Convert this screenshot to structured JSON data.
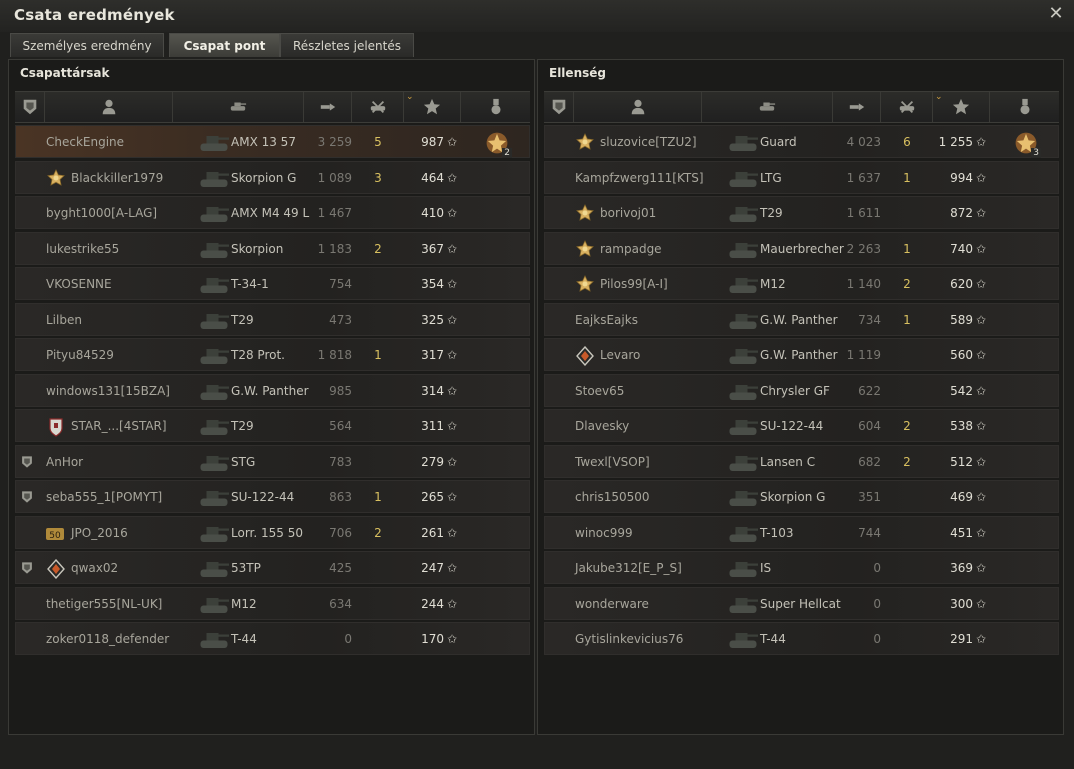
{
  "window": {
    "title": "Csata eredmények"
  },
  "tabs": [
    {
      "label": "Személyes eredmény",
      "active": false
    },
    {
      "label": "Csapat pont",
      "active": true
    },
    {
      "label": "Részletes jelentés",
      "active": false
    }
  ],
  "header_icons": [
    "platoon-icon",
    "player-icon",
    "tank-icon",
    "damage-icon",
    "kills-icon",
    "xp-star-icon",
    "medal-icon"
  ],
  "teams": [
    {
      "title": "Csapattársak",
      "rows": [
        {
          "player": "CheckEngine",
          "tank": "AMX 13 57",
          "damage": "3 259",
          "kills": "5",
          "xp": "987",
          "self": true,
          "medal": "2"
        },
        {
          "player": "Blackkiller1979",
          "tank": "Skorpion G",
          "damage": "1 089",
          "kills": "3",
          "xp": "464",
          "sticker": "gold"
        },
        {
          "player": "byght1000[A-LAG]",
          "tank": "AMX M4 49 L",
          "damage": "1 467",
          "kills": "",
          "xp": "410"
        },
        {
          "player": "lukestrike55",
          "tank": "Skorpion",
          "damage": "1 183",
          "kills": "2",
          "xp": "367"
        },
        {
          "player": "VKOSENNE",
          "tank": "T-34-1",
          "damage": "754",
          "kills": "",
          "xp": "354"
        },
        {
          "player": "Lilben",
          "tank": "T29",
          "damage": "473",
          "kills": "",
          "xp": "325"
        },
        {
          "player": "Pityu84529",
          "tank": "T28 Prot.",
          "damage": "1 818",
          "kills": "1",
          "xp": "317"
        },
        {
          "player": "windows131[15BZA]",
          "tank": "G.W. Panther",
          "damage": "985",
          "kills": "",
          "xp": "314"
        },
        {
          "player": "STAR_...[4STAR]",
          "tank": "T29",
          "damage": "564",
          "kills": "",
          "xp": "311",
          "sticker": "shield"
        },
        {
          "player": "AnHor",
          "tank": "STG",
          "damage": "783",
          "kills": "",
          "xp": "279",
          "platoon": true
        },
        {
          "player": "seba555_1[POMYT]",
          "tank": "SU-122-44",
          "damage": "863",
          "kills": "1",
          "xp": "265",
          "platoon": true
        },
        {
          "player": "JPO_2016",
          "tank": "Lorr. 155 50",
          "damage": "706",
          "kills": "2",
          "xp": "261",
          "sticker": "fifty"
        },
        {
          "player": "qwax02",
          "tank": "53TP",
          "damage": "425",
          "kills": "",
          "xp": "247",
          "platoon": true,
          "sticker": "diamond"
        },
        {
          "player": "thetiger555[NL-UK]",
          "tank": "M12",
          "damage": "634",
          "kills": "",
          "xp": "244"
        },
        {
          "player": "zoker0118_defender",
          "tank": "T-44",
          "damage": "0",
          "kills": "",
          "xp": "170"
        }
      ]
    },
    {
      "title": "Ellenség",
      "rows": [
        {
          "player": "sluzovice[TZU2]",
          "tank": "Guard",
          "damage": "4 023",
          "kills": "6",
          "xp": "1 255",
          "sticker": "gold",
          "medal": "3"
        },
        {
          "player": "Kampfzwerg111[KTS]",
          "tank": "LTG",
          "damage": "1 637",
          "kills": "1",
          "xp": "994"
        },
        {
          "player": "borivoj01",
          "tank": "T29",
          "damage": "1 611",
          "kills": "",
          "xp": "872",
          "sticker": "gold"
        },
        {
          "player": "rampadge",
          "tank": "Mauerbrecher",
          "damage": "2 263",
          "kills": "1",
          "xp": "740",
          "sticker": "gold"
        },
        {
          "player": "Pilos99[A-I]",
          "tank": "M12",
          "damage": "1 140",
          "kills": "2",
          "xp": "620",
          "sticker": "gold"
        },
        {
          "player": "EajksEajks",
          "tank": "G.W. Panther",
          "damage": "734",
          "kills": "1",
          "xp": "589"
        },
        {
          "player": "Levaro",
          "tank": "G.W. Panther",
          "damage": "1 119",
          "kills": "",
          "xp": "560",
          "sticker": "diamond"
        },
        {
          "player": "Stoev65",
          "tank": "Chrysler GF",
          "damage": "622",
          "kills": "",
          "xp": "542"
        },
        {
          "player": "Dlavesky",
          "tank": "SU-122-44",
          "damage": "604",
          "kills": "2",
          "xp": "538"
        },
        {
          "player": "Twexl[VSOP]",
          "tank": "Lansen C",
          "damage": "682",
          "kills": "2",
          "xp": "512"
        },
        {
          "player": "chris150500",
          "tank": "Skorpion G",
          "damage": "351",
          "kills": "",
          "xp": "469"
        },
        {
          "player": "winoc999",
          "tank": "T-103",
          "damage": "744",
          "kills": "",
          "xp": "451"
        },
        {
          "player": "Jakube312[E_P_S]",
          "tank": "IS",
          "damage": "0",
          "kills": "",
          "xp": "369"
        },
        {
          "player": "wonderware",
          "tank": "Super Hellcat",
          "damage": "0",
          "kills": "",
          "xp": "300"
        },
        {
          "player": "Gytislinkevicius76",
          "tank": "T-44",
          "damage": "0",
          "kills": "",
          "xp": "291"
        }
      ]
    }
  ],
  "star_glyph": "✩",
  "close_glyph": "✕"
}
